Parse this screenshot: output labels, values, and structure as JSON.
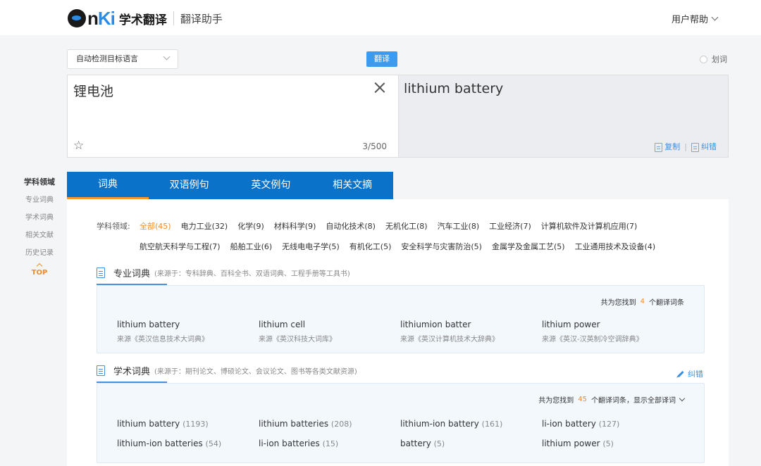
{
  "header": {
    "logo_mark_a": "n",
    "logo_mark_b": "Ki",
    "logo_name": "学术翻译",
    "logo_sub": "翻译助手",
    "help": "用户帮助"
  },
  "toolbar": {
    "target_language": "自动检测目标语言",
    "translate_label": "翻译",
    "word_select_label": "划词"
  },
  "source": {
    "text": "锂电池",
    "count": "3/500"
  },
  "target": {
    "text": "lithium battery",
    "copy_label": "复制",
    "separator": "|",
    "correct_label": "纠错"
  },
  "sidebar": {
    "title": "学科领域",
    "items": [
      "专业词典",
      "学术词典",
      "相关文献",
      "历史记录"
    ],
    "top_label": "TOP"
  },
  "tabs": [
    {
      "label": "词典"
    },
    {
      "label": "双语例句"
    },
    {
      "label": "英文例句"
    },
    {
      "label": "相关文摘"
    }
  ],
  "fields": {
    "label": "学科领域:",
    "row1": [
      "全部(45)",
      "电力工业(32)",
      "化学(9)",
      "材料科学(9)",
      "自动化技术(8)",
      "无机化工(8)",
      "汽车工业(8)",
      "工业经济(7)",
      "计算机软件及计算机应用(7)"
    ],
    "row2": [
      "航空航天科学与工程(7)",
      "船舶工业(6)",
      "无线电电子学(5)",
      "有机化工(5)",
      "安全科学与灾害防治(5)",
      "金属学及金属工艺(5)",
      "工业通用技术及设备(4)"
    ]
  },
  "professional": {
    "title": "专业词典",
    "note": "(来源于：专科辞典、百科全书、双语词典、工程手册等工具书)",
    "info_a": "共为您找到",
    "info_num": "4",
    "info_b": "个翻译词条",
    "terms": [
      {
        "term": "lithium battery",
        "source": "来源《英汉信息技术大词典》"
      },
      {
        "term": "lithium cell",
        "source": "来源《英汉科技大词库》"
      },
      {
        "term": "lithiumion batter",
        "source": "来源《英汉计算机技术大辞典》"
      },
      {
        "term": "lithium power",
        "source": "来源《英汉-汉英制冷空调辞典》"
      }
    ]
  },
  "academic": {
    "title": "学术词典",
    "note": "(来源于：期刊论文、博硕论文、会议论文、图书等各类文献资源)",
    "edit_label": "纠错",
    "info_a": "共为您找到",
    "info_num": "45",
    "info_b": "个翻译词条，显示全部译词",
    "terms": [
      {
        "term": "lithium battery",
        "count": "(1193)"
      },
      {
        "term": "lithium batteries",
        "count": "(208)"
      },
      {
        "term": "lithium-ion battery",
        "count": "(161)"
      },
      {
        "term": "li-ion battery",
        "count": "(127)"
      },
      {
        "term": "lithium-ion batteries",
        "count": "(54)"
      },
      {
        "term": "li-ion batteries",
        "count": "(15)"
      },
      {
        "term": "battery",
        "count": "(5)"
      },
      {
        "term": "lithium power",
        "count": "(5)"
      }
    ]
  }
}
